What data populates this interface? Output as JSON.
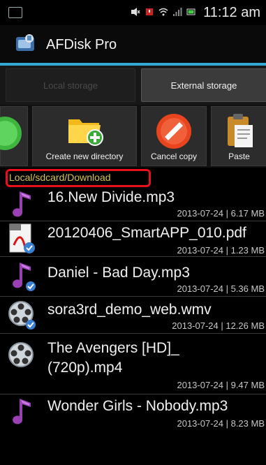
{
  "status_bar": {
    "time": "11:12 am"
  },
  "app": {
    "title": "AFDisk Pro"
  },
  "storage_tabs": {
    "local": "Local storage",
    "external": "External storage"
  },
  "toolbar": {
    "create_label": "Create new directory",
    "cancel_label": "Cancel copy",
    "paste_label": "Paste"
  },
  "path": "Local/sdcard/Download",
  "files": [
    {
      "name": "16.New Divide.mp3",
      "meta": "2013-07-24 | 6.17 MB",
      "icon": "music-note-icon"
    },
    {
      "name": "20120406_SmartAPP_010.pdf",
      "meta": "2013-07-24 | 1.23 MB",
      "icon": "pdf-icon"
    },
    {
      "name": "Daniel - Bad Day.mp3",
      "meta": "2013-07-24 | 5.36 MB",
      "icon": "music-note-icon"
    },
    {
      "name": "sora3rd_demo_web.wmv",
      "meta": "2013-07-24 | 12.26 MB",
      "icon": "film-reel-icon"
    },
    {
      "name_line1": "The Avengers [HD]_",
      "name_line2": "(720p).mp4",
      "meta": "2013-07-24 | 9.47 MB",
      "icon": "film-reel-icon"
    },
    {
      "name": "Wonder Girls - Nobody.mp3",
      "meta": "2013-07-24 | 8.23 MB",
      "icon": "music-note-icon"
    }
  ],
  "colors": {
    "accent_blue": "#33a9d6",
    "path_text": "#d8c24a",
    "highlight_red": "#e8101b"
  }
}
